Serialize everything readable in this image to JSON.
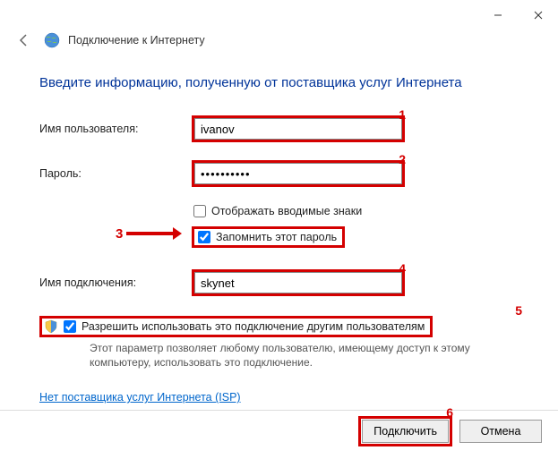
{
  "window": {
    "title": "Подключение к Интернету"
  },
  "instruction": "Введите информацию, полученную от поставщика услуг Интернета",
  "fields": {
    "username_label": "Имя пользователя:",
    "username_value": "ivanov",
    "password_label": "Пароль:",
    "password_value": "••••••••••",
    "show_chars_label": "Отображать вводимые знаки",
    "show_chars_checked": false,
    "remember_label": "Запомнить этот пароль",
    "remember_checked": true,
    "connection_name_label": "Имя подключения:",
    "connection_name_value": "skynet"
  },
  "allow": {
    "label": "Разрешить использовать это подключение другим пользователям",
    "checked": true,
    "description": "Этот параметр позволяет любому пользователю, имеющему доступ к этому компьютеру, использовать это подключение."
  },
  "isp_link": "Нет поставщика услуг Интернета (ISP)",
  "buttons": {
    "connect": "Подключить",
    "cancel": "Отмена"
  },
  "annotations": {
    "n1": "1",
    "n2": "2",
    "n3": "3",
    "n4": "4",
    "n5": "5",
    "n6": "6"
  },
  "colors": {
    "accent_blue": "#003399",
    "highlight_red": "#d40000",
    "link": "#0066cc"
  }
}
